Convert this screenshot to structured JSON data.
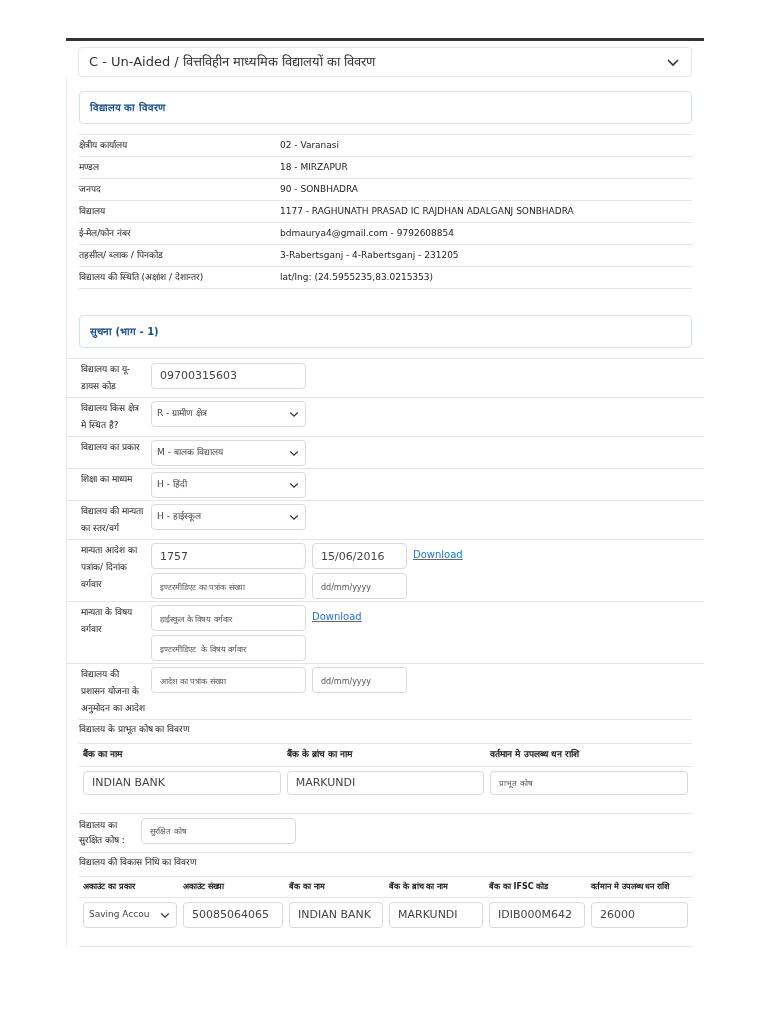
{
  "accordion": {
    "title": "C - Un-Aided / वित्तविहीन माध्यमिक विद्यालयों का विवरण",
    "expanded": true
  },
  "school_details": {
    "heading": "विद्यालय का विवरण",
    "rows": [
      {
        "label": "क्षेत्रीय कार्यालय",
        "value": "02 -  Varanasi"
      },
      {
        "label": "मण्डल",
        "value": "18 -  MIRZAPUR"
      },
      {
        "label": "जनपद",
        "value": "90 -  SONBHADRA"
      },
      {
        "label": "विद्यालय",
        "value": "1177 -  RAGHUNATH PRASAD IC RAJDHAN ADALGANJ SONBHADRA"
      },
      {
        "label": "ई-मेल/फोन नंबर",
        "value": "bdmaurya4@gmail.com -  9792608854"
      },
      {
        "label": "तहसील/ ब्लाक / पिनकोड",
        "value": "3-Rabertsganj -  4-Rabertsganj -  231205"
      },
      {
        "label": "विद्यालय की स्थिति (अक्षांश / देशान्तर)",
        "value": "lat/lng: (24.5955235,83.0215353)"
      }
    ]
  },
  "info_part1": {
    "heading": "सुचना (भाग - 1)",
    "fields": [
      {
        "kind": "input",
        "label": "विद्यालय का यू-डायस कोड",
        "value": "09700315603"
      },
      {
        "kind": "select",
        "label": "विद्यालय किस क्षेत्र मे स्थित है?",
        "value": "R - ग्रामीण क्षेत्र"
      },
      {
        "kind": "select",
        "label": "विद्यालय का प्रकार",
        "value": "M - बालक विद्यालय"
      },
      {
        "kind": "select",
        "label": "शिक्षा का माध्यम",
        "value": "H - हिंदी"
      },
      {
        "kind": "select",
        "label": "विद्यालय की मान्यता का स्तर/वर्ग",
        "value": "H - हाईस्कूल"
      },
      {
        "kind": "pair",
        "label": "मान्यता आदेश का पत्रांक/ दिनांक वर्गवार",
        "link": "Download",
        "inputs": [
          {
            "value": "1757"
          },
          {
            "value": "15/06/2016"
          },
          {
            "placeholder": "इण्टरमीडिएट का पत्रांक संख्या"
          },
          {
            "placeholder": "dd/mm/yyyy"
          }
        ]
      },
      {
        "kind": "single",
        "label": "मान्यता के विषय वर्गवार",
        "link": "Download",
        "inputs": [
          {
            "placeholder": "हाईस्कूल के विषय वर्गवार"
          },
          {
            "placeholder": "इण्टरमीडिएट  के विषय वर्गवार"
          }
        ]
      },
      {
        "kind": "pair",
        "label": "विद्यालय की प्रशासन योजना के अनुमोदन का आदेश",
        "inputs": [
          {
            "placeholder": "आदेश का पत्रांक संख्या"
          },
          {
            "placeholder": "dd/mm/yyyy"
          }
        ]
      }
    ]
  },
  "endowment_fund": {
    "title": "विद्यालय के प्राभूत कोष का विवरण",
    "columns": [
      "बैंक का नाम",
      "बैंक के ब्रांच का नाम",
      "वर्तमान मे उपलब्ध धन राशि"
    ],
    "cells": [
      {
        "value": "INDIAN BANK"
      },
      {
        "value": "MARKUNDI"
      },
      {
        "placeholder": "प्राभूत कोष"
      }
    ]
  },
  "reserve_fund": {
    "label": "विद्यालय का सुरक्षित कोष :",
    "placeholder": "सुरक्षित कोष"
  },
  "development_fund": {
    "title": "विद्यालय की विकास निधि का विवरण",
    "columns": [
      "अकाउंट का प्रकार",
      "अकाउंट संख्या",
      "बैंक का नाम",
      "बैंक के ब्रांच का नाम",
      "बैंक का IFSC कोड",
      "वर्तमान मे उपलब्ध धन राशि"
    ],
    "cells": [
      {
        "kind": "select",
        "value": "Saving Accou"
      },
      {
        "kind": "input",
        "value": "50085064065"
      },
      {
        "kind": "input",
        "value": "INDIAN BANK"
      },
      {
        "kind": "input",
        "value": "MARKUNDI"
      },
      {
        "kind": "input",
        "value": "IDIB000M642"
      },
      {
        "kind": "input",
        "value": "26000"
      }
    ]
  }
}
